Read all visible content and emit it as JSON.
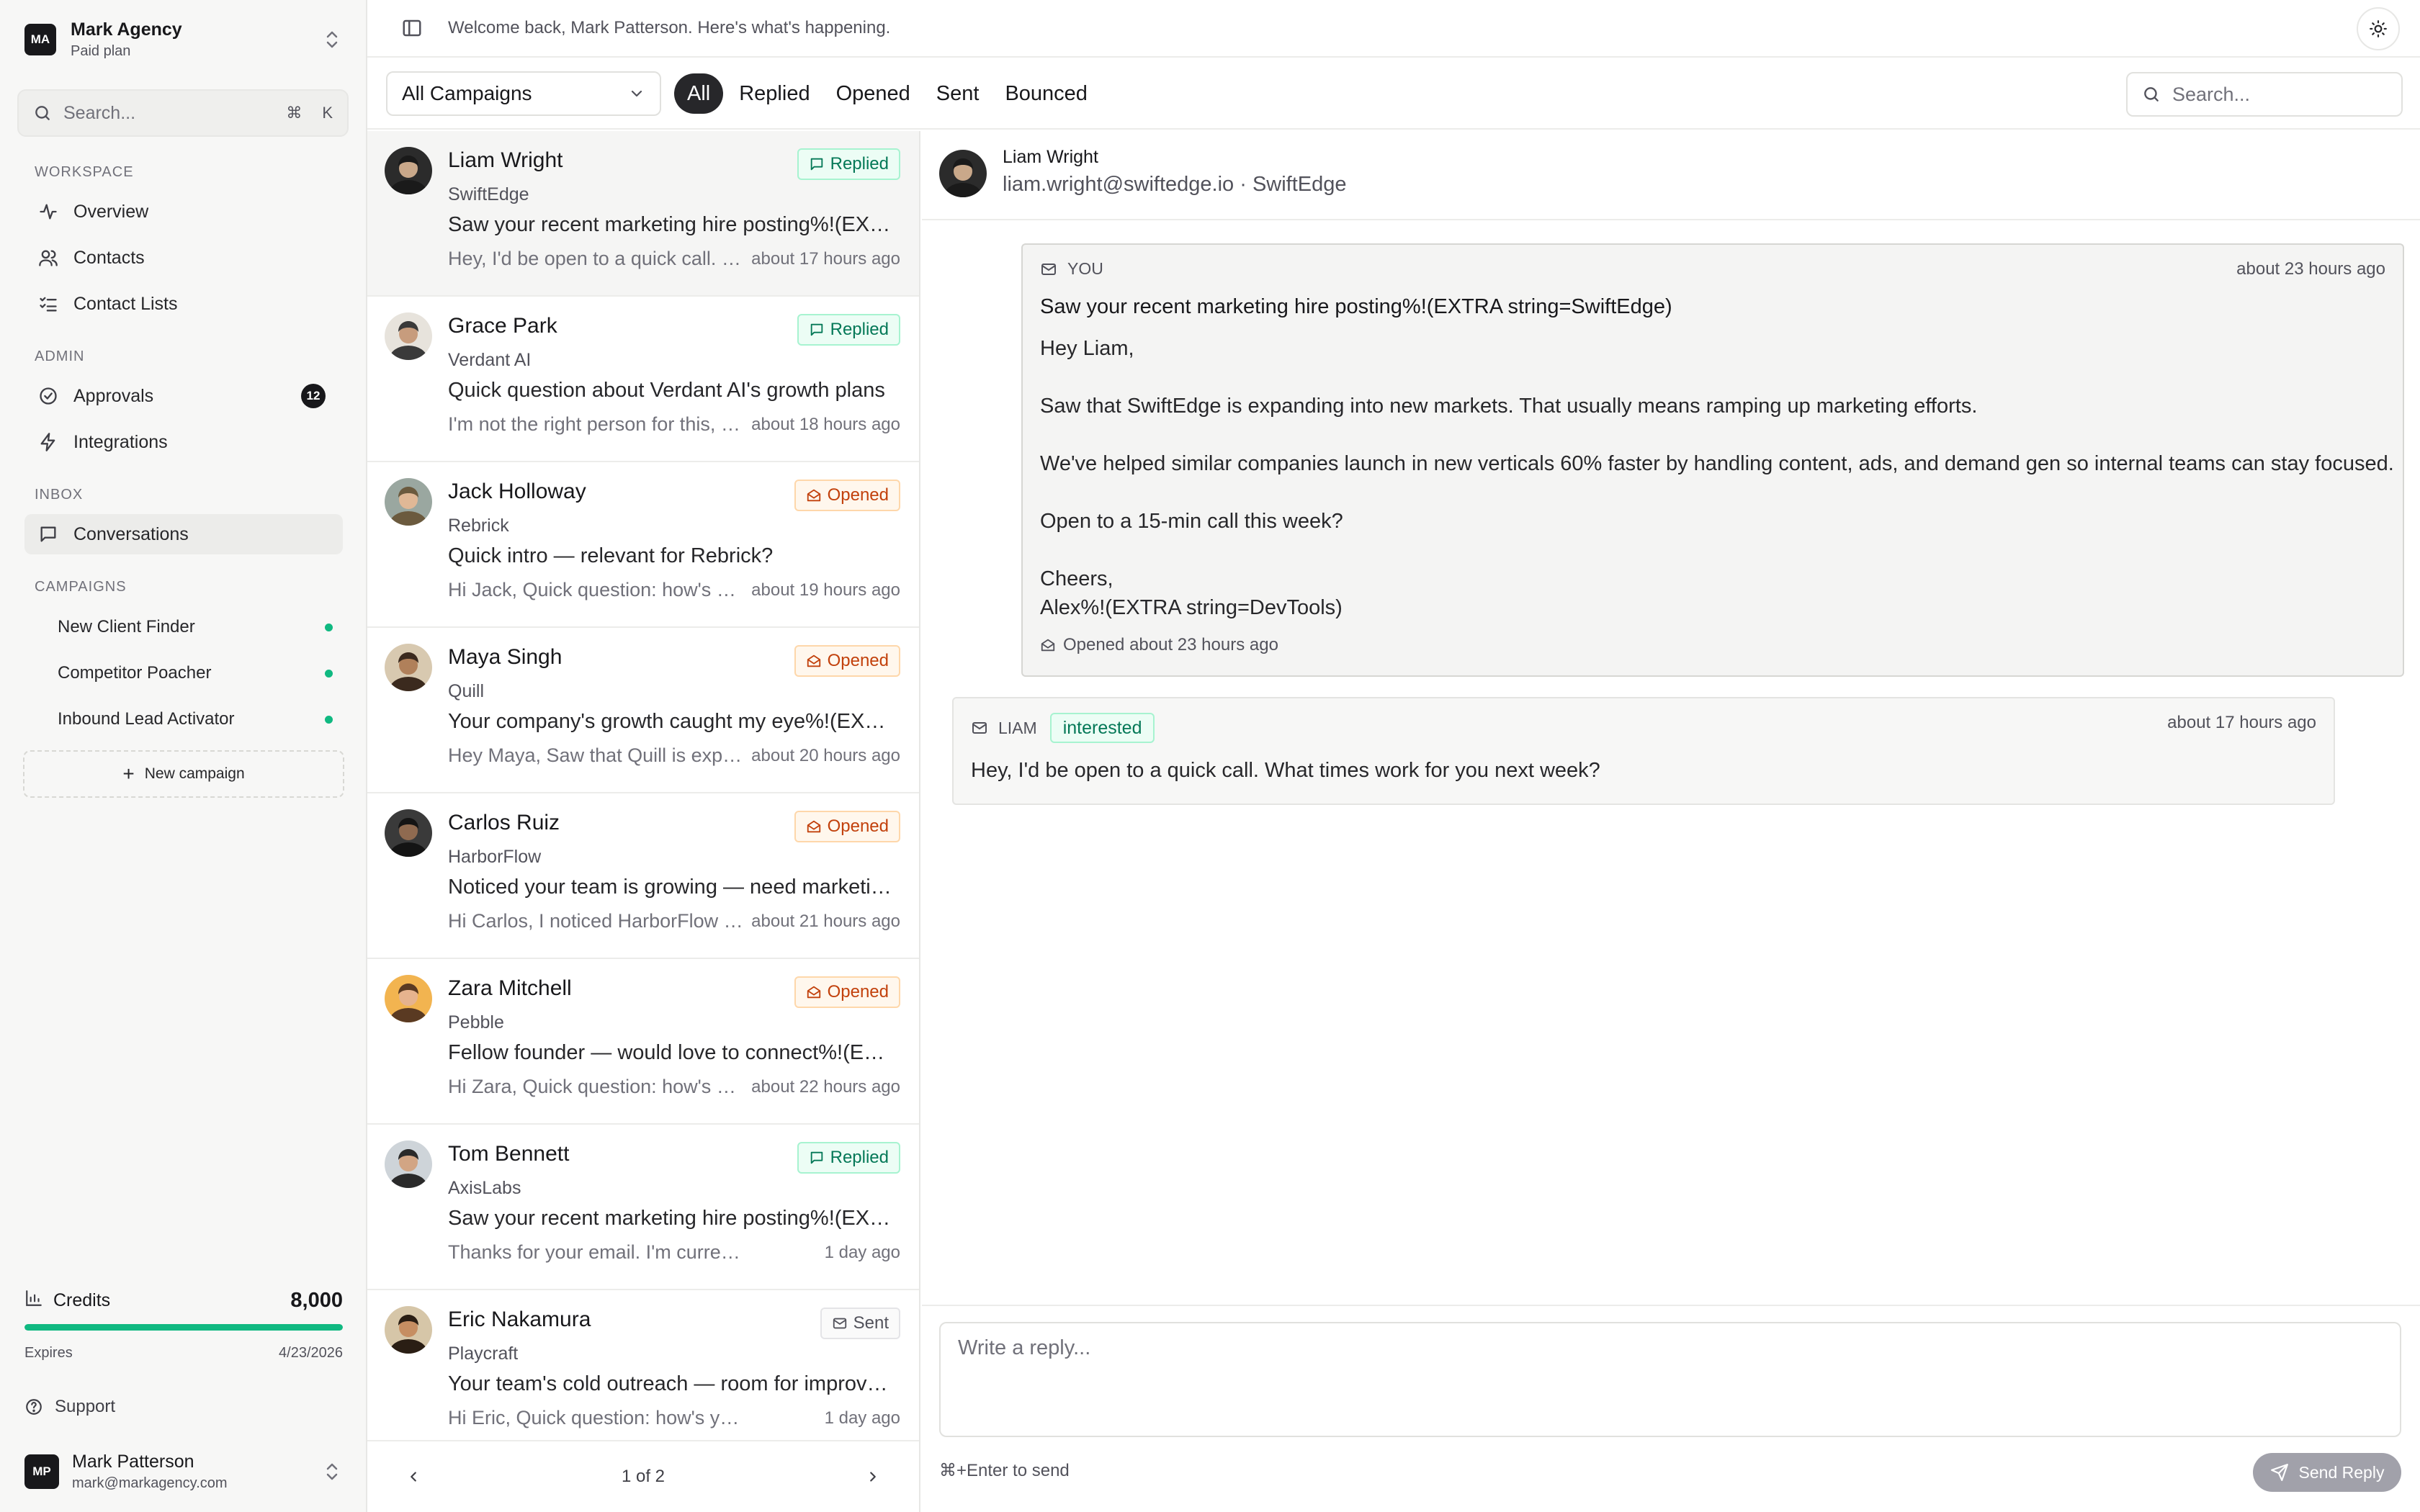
{
  "org": {
    "initials": "MA",
    "name": "Mark Agency",
    "plan": "Paid plan"
  },
  "search": {
    "placeholder": "Search...",
    "shortcut_cmd": "⌘",
    "shortcut_key": "K"
  },
  "sidebar": {
    "workspace_title": "WORKSPACE",
    "workspace_items": [
      {
        "label": "Overview",
        "icon": "activity-icon"
      },
      {
        "label": "Contacts",
        "icon": "users-icon"
      },
      {
        "label": "Contact Lists",
        "icon": "list-checks-icon"
      }
    ],
    "admin_title": "ADMIN",
    "admin_items": [
      {
        "label": "Approvals",
        "icon": "check-circle-icon",
        "badge": "12"
      },
      {
        "label": "Integrations",
        "icon": "zap-icon"
      }
    ],
    "inbox_title": "INBOX",
    "inbox_items": [
      {
        "label": "Conversations",
        "icon": "message-square-icon",
        "active": true
      }
    ],
    "campaigns_title": "CAMPAIGNS",
    "campaigns": [
      {
        "label": "New Client Finder",
        "status_color": "#10b981"
      },
      {
        "label": "Competitor Poacher",
        "status_color": "#10b981"
      },
      {
        "label": "Inbound Lead Activator",
        "status_color": "#10b981"
      }
    ],
    "new_campaign_label": "New campaign"
  },
  "credits": {
    "label": "Credits",
    "value": "8,000",
    "progress": 1.0,
    "expires_label": "Expires",
    "expires_date": "4/23/2026"
  },
  "support_label": "Support",
  "user": {
    "initials": "MP",
    "name": "Mark Patterson",
    "email": "mark@markagency.com"
  },
  "topbar": {
    "welcome": "Welcome back, Mark Patterson. Here's what's happening."
  },
  "filters": {
    "campaign_select": "All Campaigns",
    "tabs": [
      "All",
      "Replied",
      "Opened",
      "Sent",
      "Bounced"
    ],
    "active_tab": "All",
    "search_placeholder": "Search..."
  },
  "conversations": [
    {
      "name": "Liam Wright",
      "company": "SwiftEdge",
      "status": "Replied",
      "subject": "Saw your recent marketing hire posting%!(EXTRA string=SwiftEdge)",
      "preview": "Hey, I'd be open to a quick call. What times work for you next week?",
      "time": "about 17 hours ago"
    },
    {
      "name": "Grace Park",
      "company": "Verdant AI",
      "status": "Replied",
      "subject": "Quick question about Verdant AI's growth plans",
      "preview": "I'm not the right person for this, please reach out to someone else.",
      "time": "about 18 hours ago"
    },
    {
      "name": "Jack Holloway",
      "company": "Rebrick",
      "status": "Opened",
      "subject": "Quick intro — relevant for Rebrick?",
      "preview": "Hi Jack, Quick question: how's your team handling growth?",
      "time": "about 19 hours ago"
    },
    {
      "name": "Maya Singh",
      "company": "Quill",
      "status": "Opened",
      "subject": "Your company's growth caught my eye%!(EXTRA string=Quill)",
      "preview": "Hey Maya, Saw that Quill is expanding into new markets.",
      "time": "about 20 hours ago"
    },
    {
      "name": "Carlos Ruiz",
      "company": "HarborFlow",
      "status": "Opened",
      "subject": "Noticed your team is growing — need marketing support?",
      "preview": "Hi Carlos, I noticed HarborFlow is hiring across teams.",
      "time": "about 21 hours ago"
    },
    {
      "name": "Zara Mitchell",
      "company": "Pebble",
      "status": "Opened",
      "subject": "Fellow founder — would love to connect%!(EXTRA string=Pebble)",
      "preview": "Hi Zara, Quick question: how's your team handling growth?",
      "time": "about 22 hours ago"
    },
    {
      "name": "Tom Bennett",
      "company": "AxisLabs",
      "status": "Replied",
      "subject": "Saw your recent marketing hire posting%!(EXTRA string=AxisLabs)",
      "preview": "Thanks for your email. I'm currently out of office until Monday.",
      "time": "1 day ago"
    },
    {
      "name": "Eric Nakamura",
      "company": "Playcraft",
      "status": "Sent",
      "subject": "Your team's cold outreach — room for improvement?",
      "preview": "Hi Eric, Quick question: how's your team handling outreach?",
      "time": "1 day ago"
    }
  ],
  "pagination": {
    "label": "1 of 2"
  },
  "detail": {
    "name": "Liam Wright",
    "subtitle": "liam.wright@swiftedge.io · SwiftEdge",
    "you_label": "YOU",
    "you_time": "about 23 hours ago",
    "you_subject": "Saw your recent marketing hire posting%!(EXTRA string=SwiftEdge)",
    "you_body": {
      "greeting": "Hey Liam,",
      "p1": "Saw that SwiftEdge is expanding into new markets. That usually means ramping up marketing efforts.",
      "p2": "We've helped similar companies launch in new verticals 60% faster by handling content, ads, and demand gen so internal teams can stay focused.",
      "p3": "Open to a 15-min call this week?",
      "signoff": "Cheers,",
      "signature": "Alex%!(EXTRA string=DevTools)"
    },
    "you_opened": "Opened about 23 hours ago",
    "liam_label": "LIAM",
    "liam_badge": "interested",
    "liam_time": "about 17 hours ago",
    "liam_body": "Hey, I'd be open to a quick call. What times work for you next week?"
  },
  "reply": {
    "placeholder": "Write a reply...",
    "hint": "⌘+Enter to send",
    "send_label": "Send Reply"
  },
  "colors": {
    "accent_green": "#10b981",
    "replied": "#047857",
    "opened": "#c2410c"
  }
}
